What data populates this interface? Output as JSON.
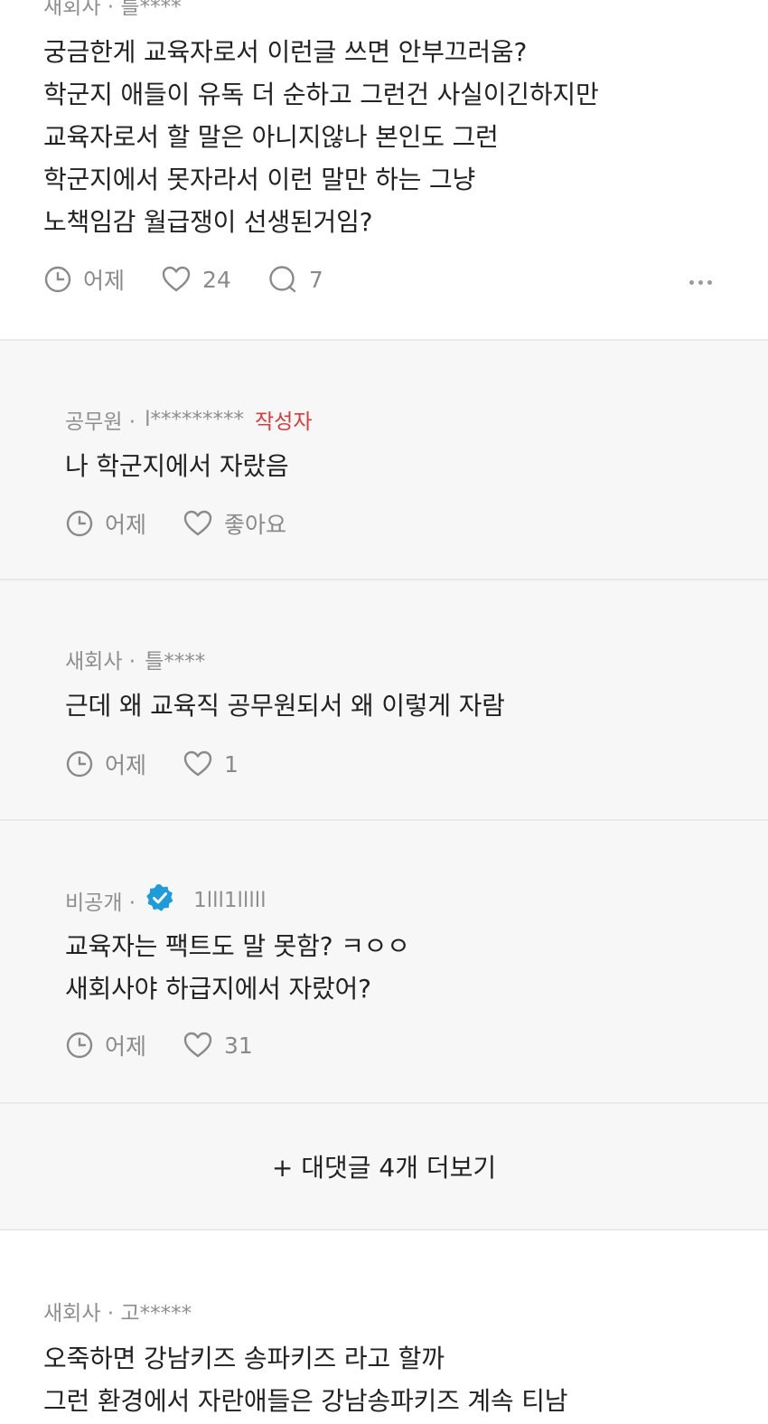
{
  "top_post": {
    "meta": "새회사 · 틀****",
    "lines": [
      "궁금한게 교육자로서 이런글 쓰면 안부끄러움?",
      "학군지 애들이 유독 더 순하고 그런건 사실이긴하지만",
      "교육자로서 할 말은 아니지않나 본인도 그런",
      "학군지에서 못자라서 이런 말만 하는 그냥",
      "노책임감 월급쟁이 선생된거임?"
    ],
    "time": "어제",
    "likes": "24",
    "comments": "7"
  },
  "replies": [
    {
      "company": "공무원 ·",
      "user": "l*********",
      "author_tag": "작성자",
      "lines": [
        "나 학군지에서 자랐음"
      ],
      "time": "어제",
      "likes": "좋아요"
    },
    {
      "company": "새회사 ·",
      "user": "틀****",
      "lines": [
        "근데 왜 교육직 공무원되서 왜 이렇게 자람"
      ],
      "time": "어제",
      "likes": "1"
    },
    {
      "company": "비공개 ·",
      "user": "1lll1lllll",
      "lines": [
        "교육자는 팩트도 말 못함? ㅋㅇㅇ",
        "새회사야 하급지에서 자랐어?"
      ],
      "time": "어제",
      "likes": "31"
    }
  ],
  "load_more": "+ 대댓글 4개 더보기",
  "bottom_post": {
    "meta": "새회사 · 고*****",
    "lines": [
      "오죽하면 강남키즈 송파키즈 라고 할까",
      "그런 환경에서 자란애들은 강남송파키즈 계속 티남"
    ]
  },
  "colors": {
    "background": "#ffffff",
    "reply_background": "#f7f7f7",
    "author_tag": "#d93a3a",
    "verified_badge": "#1f9bd8",
    "muted_text": "#8e8e8e"
  },
  "icons": [
    "clock-icon",
    "heart-icon",
    "comment-icon",
    "more-icon",
    "verified-badge-icon"
  ]
}
